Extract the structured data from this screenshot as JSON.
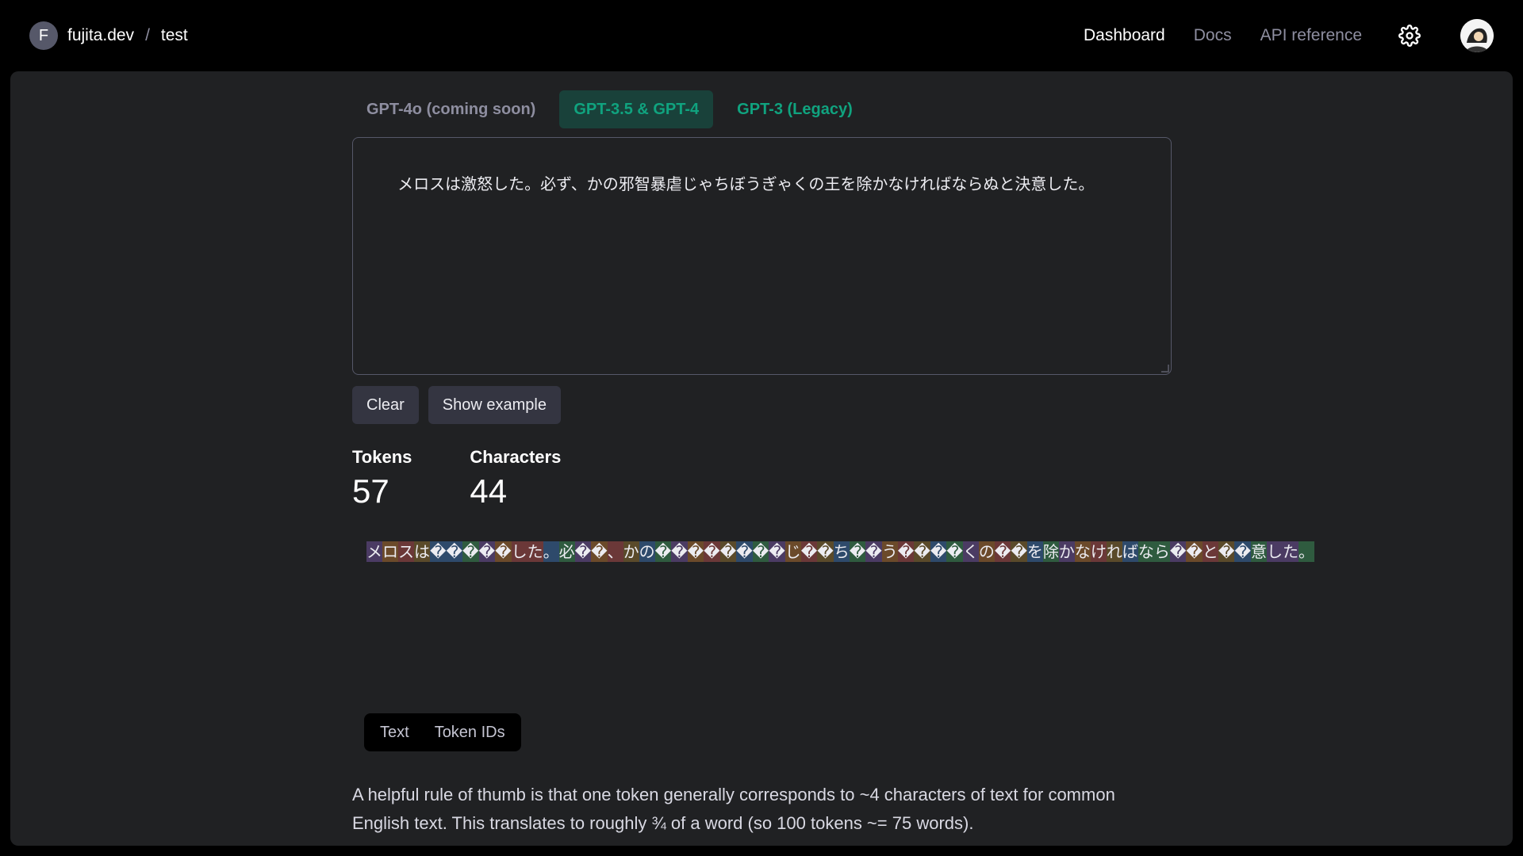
{
  "header": {
    "org_initial": "F",
    "org_name": "fujita.dev",
    "separator": "/",
    "project_name": "test",
    "nav": [
      {
        "label": "Dashboard",
        "active": true
      },
      {
        "label": "Docs",
        "active": false
      },
      {
        "label": "API reference",
        "active": false
      }
    ],
    "icons": {
      "settings": "gear-icon",
      "user": "avatar"
    }
  },
  "model_tabs": [
    {
      "label": "GPT-4o (coming soon)",
      "state": "disabled"
    },
    {
      "label": "GPT-3.5 & GPT-4",
      "state": "active"
    },
    {
      "label": "GPT-3 (Legacy)",
      "state": "plain"
    }
  ],
  "editor": {
    "value": "メロスは激怒した。必ず、かの邪智暴虐じゃちぼうぎゃくの王を除かなければならぬと決意した。"
  },
  "actions": {
    "clear_label": "Clear",
    "example_label": "Show example"
  },
  "stats": {
    "tokens_label": "Tokens",
    "tokens_value": "57",
    "characters_label": "Characters",
    "characters_value": "44"
  },
  "tokens": [
    {
      "text": "メ",
      "color": "#4b3b63"
    },
    {
      "text": "ロ",
      "color": "#6b4a2a"
    },
    {
      "text": "ス",
      "color": "#6b3838"
    },
    {
      "text": "は",
      "color": "#5a4a2a"
    },
    {
      "text": "�",
      "color": "#2e4a6b"
    },
    {
      "text": "�",
      "color": "#2e4a6b"
    },
    {
      "text": "�",
      "color": "#2f5b3f"
    },
    {
      "text": "�",
      "color": "#4b3b63"
    },
    {
      "text": "�",
      "color": "#6b4a2a"
    },
    {
      "text": "した",
      "color": "#6b3838"
    },
    {
      "text": "。",
      "color": "#2e4a6b"
    },
    {
      "text": "必",
      "color": "#2f5b3f"
    },
    {
      "text": "�",
      "color": "#4b3b63"
    },
    {
      "text": "�",
      "color": "#6b4a2a"
    },
    {
      "text": "、",
      "color": "#6b3838"
    },
    {
      "text": "か",
      "color": "#5a4a2a"
    },
    {
      "text": "の",
      "color": "#2e4a6b"
    },
    {
      "text": "�",
      "color": "#2f5b3f"
    },
    {
      "text": "�",
      "color": "#4b3b63"
    },
    {
      "text": "�",
      "color": "#6b4a2a"
    },
    {
      "text": "�",
      "color": "#6b3838"
    },
    {
      "text": "�",
      "color": "#5a4a2a"
    },
    {
      "text": "�",
      "color": "#2e4a6b"
    },
    {
      "text": "�",
      "color": "#2f5b3f"
    },
    {
      "text": "�",
      "color": "#4b3b63"
    },
    {
      "text": "じ",
      "color": "#6b4a2a"
    },
    {
      "text": "�",
      "color": "#6b3838"
    },
    {
      "text": "�",
      "color": "#5a4a2a"
    },
    {
      "text": "ち",
      "color": "#2e4a6b"
    },
    {
      "text": "�",
      "color": "#2f5b3f"
    },
    {
      "text": "�",
      "color": "#4b3b63"
    },
    {
      "text": "う",
      "color": "#6b4a2a"
    },
    {
      "text": "�",
      "color": "#6b3838"
    },
    {
      "text": "�",
      "color": "#5a4a2a"
    },
    {
      "text": "�",
      "color": "#2e4a6b"
    },
    {
      "text": "�",
      "color": "#2f5b3f"
    },
    {
      "text": "く",
      "color": "#4b3b63"
    },
    {
      "text": "の",
      "color": "#6b4a2a"
    },
    {
      "text": "�",
      "color": "#6b3838"
    },
    {
      "text": "�",
      "color": "#5a4a2a"
    },
    {
      "text": "を",
      "color": "#2e4a6b"
    },
    {
      "text": "除",
      "color": "#2f5b3f"
    },
    {
      "text": "か",
      "color": "#4b3b63"
    },
    {
      "text": "な",
      "color": "#6b4a2a"
    },
    {
      "text": "け",
      "color": "#6b3838"
    },
    {
      "text": "れ",
      "color": "#5a4a2a"
    },
    {
      "text": "ば",
      "color": "#2e4a6b"
    },
    {
      "text": "なら",
      "color": "#2f5b3f"
    },
    {
      "text": "�",
      "color": "#4b3b63"
    },
    {
      "text": "�",
      "color": "#6b4a2a"
    },
    {
      "text": "と",
      "color": "#6b3838"
    },
    {
      "text": "�",
      "color": "#5a4a2a"
    },
    {
      "text": "�",
      "color": "#2e4a6b"
    },
    {
      "text": "意",
      "color": "#2f5b3f"
    },
    {
      "text": "した",
      "color": "#4b3b63"
    },
    {
      "text": "。",
      "color": "#2f5b3f"
    }
  ],
  "view_toggle": [
    {
      "label": "Text"
    },
    {
      "label": "Token IDs"
    }
  ],
  "note": {
    "text": "A helpful rule of thumb is that one token generally corresponds to ~4 characters of text for common English text. This translates to roughly ¾ of a word (so 100 tokens ~= 75 words)."
  }
}
